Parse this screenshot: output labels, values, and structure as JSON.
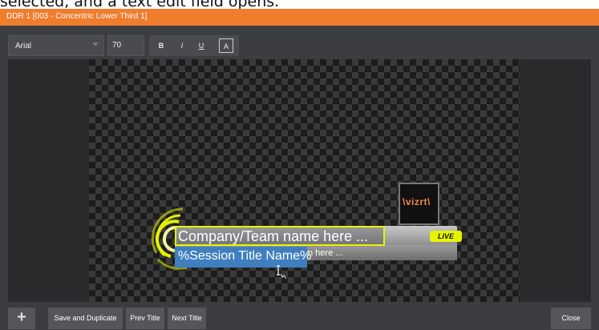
{
  "caption": {
    "text": "selected, and a text edit field opens."
  },
  "window": {
    "title": "DDR 1  [003 - Concentric Lower Third 1]"
  },
  "toolbar": {
    "font_family": "Arial",
    "font_size": "70",
    "bold_label": "B",
    "italic_label": "I",
    "underline_label": "U",
    "color_label": "A"
  },
  "title_graphic": {
    "company_text": "Company/Team name here ...",
    "session_text": "%Session Title Name%",
    "subtitle_partial": "n here ...",
    "live_badge": "LIVE",
    "logo_text": "\\vizrt\\"
  },
  "footer": {
    "add_label": "+",
    "save_duplicate_label": "Save and Duplicate",
    "prev_title_label": "Prev Title",
    "next_title_label": "Next Title",
    "close_label": "Close"
  },
  "colors": {
    "titlebar": "#ef7d2e",
    "accent_yellow": "#e6f200",
    "selection_blue": "#3f7fbf",
    "toolbar_bg": "#3c3d41"
  },
  "icons": {
    "dropdown": "chevron-down-icon",
    "cursor": "text-cursor-icon"
  }
}
